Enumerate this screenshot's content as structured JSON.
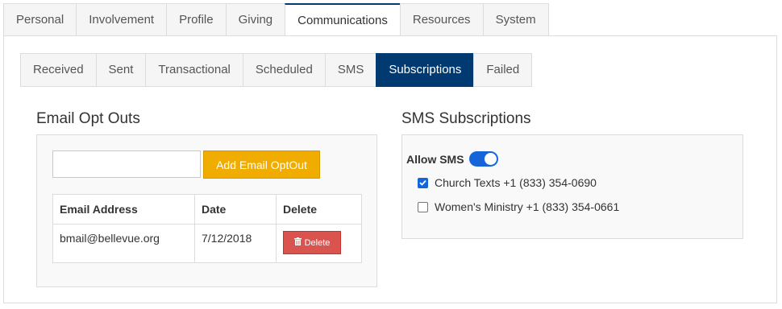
{
  "top_tabs": [
    "Personal",
    "Involvement",
    "Profile",
    "Giving",
    "Communications",
    "Resources",
    "System"
  ],
  "sub_tabs": [
    "Received",
    "Sent",
    "Transactional",
    "Scheduled",
    "SMS",
    "Subscriptions",
    "Failed"
  ],
  "email_optouts": {
    "heading": "Email Opt Outs",
    "input_value": "",
    "add_button": "Add Email OptOut",
    "columns": [
      "Email Address",
      "Date",
      "Delete"
    ],
    "rows": [
      {
        "email": "bmail@bellevue.org",
        "date": "7/12/2018",
        "action": "Delete"
      }
    ]
  },
  "sms": {
    "heading": "SMS Subscriptions",
    "allow_label": "Allow SMS",
    "allow_enabled": true,
    "items": [
      {
        "label": "Church Texts +1 (833) 354-0690",
        "checked": true
      },
      {
        "label": "Women's Ministry +1 (833) 354-0661",
        "checked": false
      }
    ]
  },
  "colors": {
    "nav_active": "#003a70",
    "add_button": "#f0ad00",
    "delete_button": "#d9534f",
    "toggle_on": "#1565d8"
  }
}
